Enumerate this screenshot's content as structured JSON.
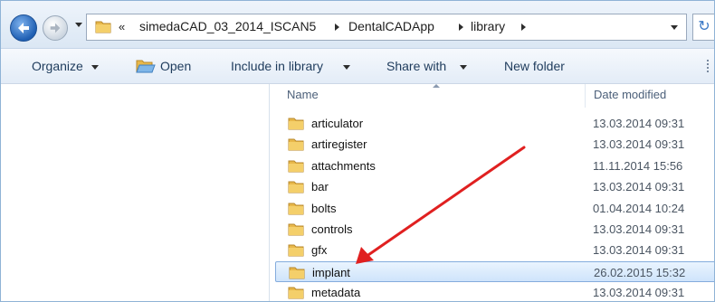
{
  "address": {
    "overflow": "«",
    "crumbs": [
      "simedaCAD_03_2014_ISCAN5",
      "DentalCADApp",
      "library"
    ],
    "refresh_glyph": "↻"
  },
  "toolbar": {
    "organize": "Organize",
    "open": "Open",
    "include_in_library": "Include in library",
    "share_with": "Share with",
    "new_folder": "New folder"
  },
  "columns": {
    "name": "Name",
    "date_modified": "Date modified"
  },
  "files": [
    {
      "name": "articulator",
      "date": "13.03.2014 09:31"
    },
    {
      "name": "artiregister",
      "date": "13.03.2014 09:31"
    },
    {
      "name": "attachments",
      "date": "11.11.2014 15:56"
    },
    {
      "name": "bar",
      "date": "13.03.2014 09:31"
    },
    {
      "name": "bolts",
      "date": "01.04.2014 10:24"
    },
    {
      "name": "controls",
      "date": "13.03.2014 09:31"
    },
    {
      "name": "gfx",
      "date": "13.03.2014 09:31"
    },
    {
      "name": "implant",
      "date": "26.02.2015 15:32",
      "selected": true
    },
    {
      "name": "metadata",
      "date": "13.03.2014 09:31"
    }
  ],
  "colors": {
    "annotation_arrow": "#e02020",
    "selection": "#cfe4fb",
    "folder": "#e8b84a"
  },
  "icons": {
    "folder": "folder-icon",
    "back": "back-arrow-icon",
    "forward": "forward-arrow-icon",
    "open": "open-folder-icon",
    "refresh": "refresh-icon"
  }
}
